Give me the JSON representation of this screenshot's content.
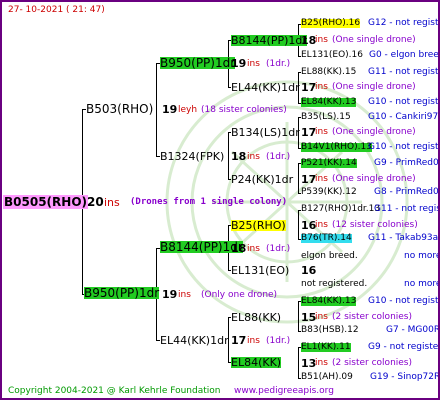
{
  "header": {
    "date": "27- 10-2021 ( 21: 47)"
  },
  "footer": {
    "copyright": "Copyright 2004-2021 @ Karl Kehrle Foundation",
    "site": "www.pedigreeapis.org"
  },
  "colors": {
    "border": "#6a0080",
    "ins": "#cc0000",
    "info": "#8800cc",
    "link": "#0000cc",
    "green_hl": "#22cc22",
    "yellow_hl": "#ffff00",
    "cyan_hl": "#33ddee",
    "pink_hl": "#ff99ff"
  },
  "subject": {
    "name": "B0505(RHO)",
    "ins_count": "20",
    "ins": "ins",
    "note": "(Drones from 1 single colony)"
  },
  "p": {
    "name": "B503(RHO)",
    "ins_count": "19",
    "ins": "leyh",
    "note": "(18 sister colonies)"
  },
  "pp": {
    "name": "B950(PP)1dr",
    "ins_count": "19",
    "ins": "ins",
    "note": "(1dr.)"
  },
  "ppp": {
    "name": "B8144(PP)1dr",
    "ins_count": "18",
    "ins": "ins",
    "note": "(One single drone)"
  },
  "pppp": {
    "name": "B25(RHO).16",
    "code": "G12 - not registered"
  },
  "pppm": {
    "name": "EL131(EO).16",
    "code": "G0 - elgon breed"
  },
  "ppm": {
    "name": "EL44(KK)1dr",
    "ins_count": "17",
    "ins": "ins",
    "note": "(1dr.)"
  },
  "ppmp": {
    "name": "EL88(KK).15",
    "code": "G11 - not registered",
    "ins_count": "17",
    "ins": "ins",
    "note": "(One single drone)"
  },
  "ppmm": {
    "name": "EL84(KK).13",
    "code": "G10 - not registered"
  },
  "pm": {
    "name": "B1324(FPK)",
    "ins_count": "18",
    "ins": "ins",
    "note": "(1dr.)"
  },
  "pmp": {
    "name": "B134(LS)1dr",
    "ins_count": "17",
    "ins": "ins",
    "note": "(One single drone)"
  },
  "pmpp": {
    "name": "B35(LS).15",
    "code": "G10 - Cankiri97Q"
  },
  "pmpm": {
    "name": "B14V1(RHO).13",
    "code": "G10 - not registered"
  },
  "pmm": {
    "name": "P24(KK)1dr",
    "ins_count": "17",
    "ins": "ins",
    "note": "(One single drone)"
  },
  "pmmp": {
    "name": "P521(KK).14",
    "code": "G9 - PrimRed01"
  },
  "pmmm": {
    "name": "P539(KK).12",
    "code": "G8 - PrimRed01"
  },
  "m": {
    "name": "B950(PP)1dr",
    "ins_count": "19",
    "ins": "ins",
    "note": "(Only one drone)"
  },
  "mp": {
    "name": "B8144(PP)1dr",
    "ins_count": "18",
    "ins": "ins",
    "note": "(1dr.)"
  },
  "mpp": {
    "name": "B25(RHO)",
    "ins_count": "16",
    "ins": "ins",
    "note": "(12 sister colonies)"
  },
  "mppp": {
    "name": "B127(RHO)1dr.13",
    "code": "G11 - not registered"
  },
  "mppm": {
    "name": "B76(TR).14",
    "code": "G11 - Takab93aR"
  },
  "mpm": {
    "name": "EL131(EO)",
    "ins_count": "16",
    "ins": ""
  },
  "mpmp": {
    "name": "elgon breed.",
    "code": "no more"
  },
  "mpmm": {
    "name": "not registered.",
    "code": "no more"
  },
  "mm": {
    "name": "EL44(KK)1dr",
    "ins_count": "17",
    "ins": "ins",
    "note": "(1dr.)"
  },
  "mmp": {
    "name": "EL88(KK)",
    "ins_count": "15",
    "ins": "ins",
    "note": "(2 sister colonies)"
  },
  "mmpp": {
    "name": "EL84(KK).13",
    "code": "G10 - not registered"
  },
  "mmpm": {
    "name": "B83(HSB).12",
    "code": "G7 - MG00R"
  },
  "mmm": {
    "name": "EL84(KK)",
    "ins_count": "13",
    "ins": "ins",
    "note": "(2 sister colonies)"
  },
  "mmmp": {
    "name": "EL1(KK).11",
    "code": "G9 - not registered"
  },
  "mmmm": {
    "name": "B51(AH).09",
    "code": "G19 - Sinop72R"
  }
}
